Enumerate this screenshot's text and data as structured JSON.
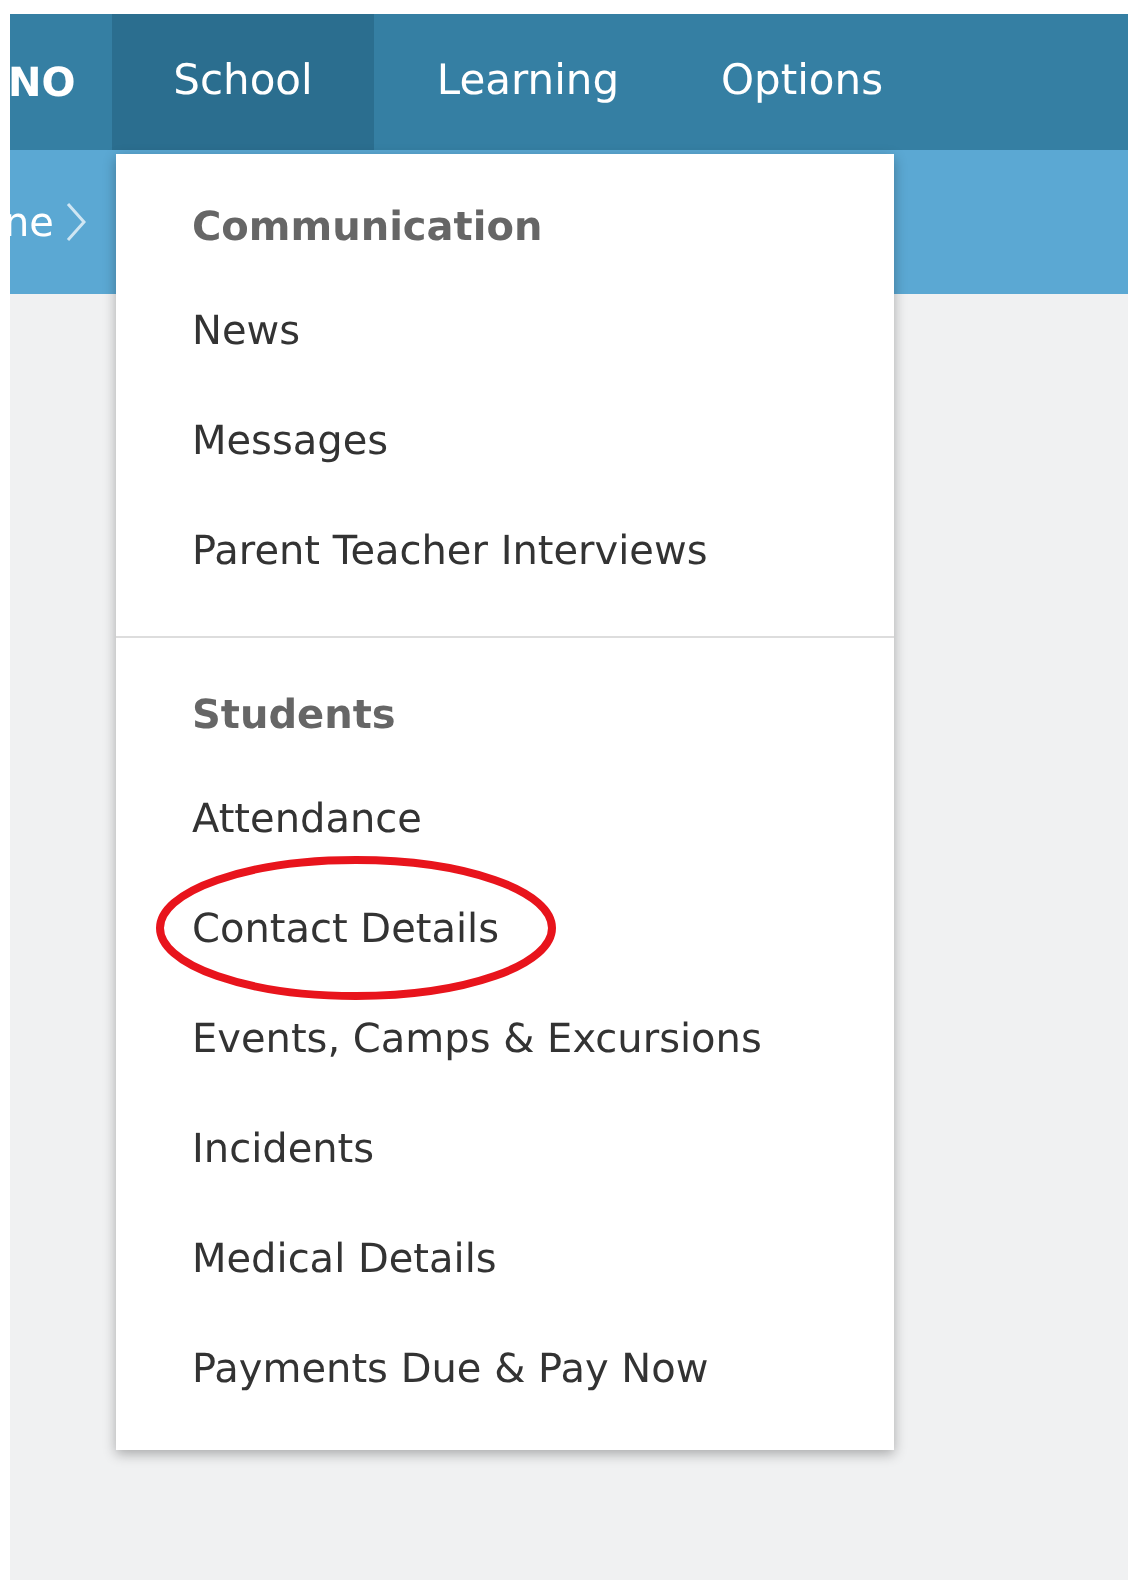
{
  "nav": {
    "brand": "NO",
    "tabs": [
      {
        "label": "School",
        "selected": true
      },
      {
        "label": "Learning",
        "selected": false
      },
      {
        "label": "Options",
        "selected": false
      }
    ]
  },
  "breadcrumb": {
    "text": "ne"
  },
  "menu": {
    "sections": [
      {
        "heading": "Communication",
        "items": [
          {
            "label": "News",
            "highlighted": false
          },
          {
            "label": "Messages",
            "highlighted": false
          },
          {
            "label": "Parent Teacher Interviews",
            "highlighted": false
          }
        ]
      },
      {
        "heading": "Students",
        "items": [
          {
            "label": "Attendance",
            "highlighted": false
          },
          {
            "label": "Contact Details",
            "highlighted": true
          },
          {
            "label": "Events, Camps & Excursions",
            "highlighted": false
          },
          {
            "label": "Incidents",
            "highlighted": false
          },
          {
            "label": "Medical Details",
            "highlighted": false
          },
          {
            "label": "Payments Due & Pay Now",
            "highlighted": false
          }
        ]
      }
    ]
  }
}
